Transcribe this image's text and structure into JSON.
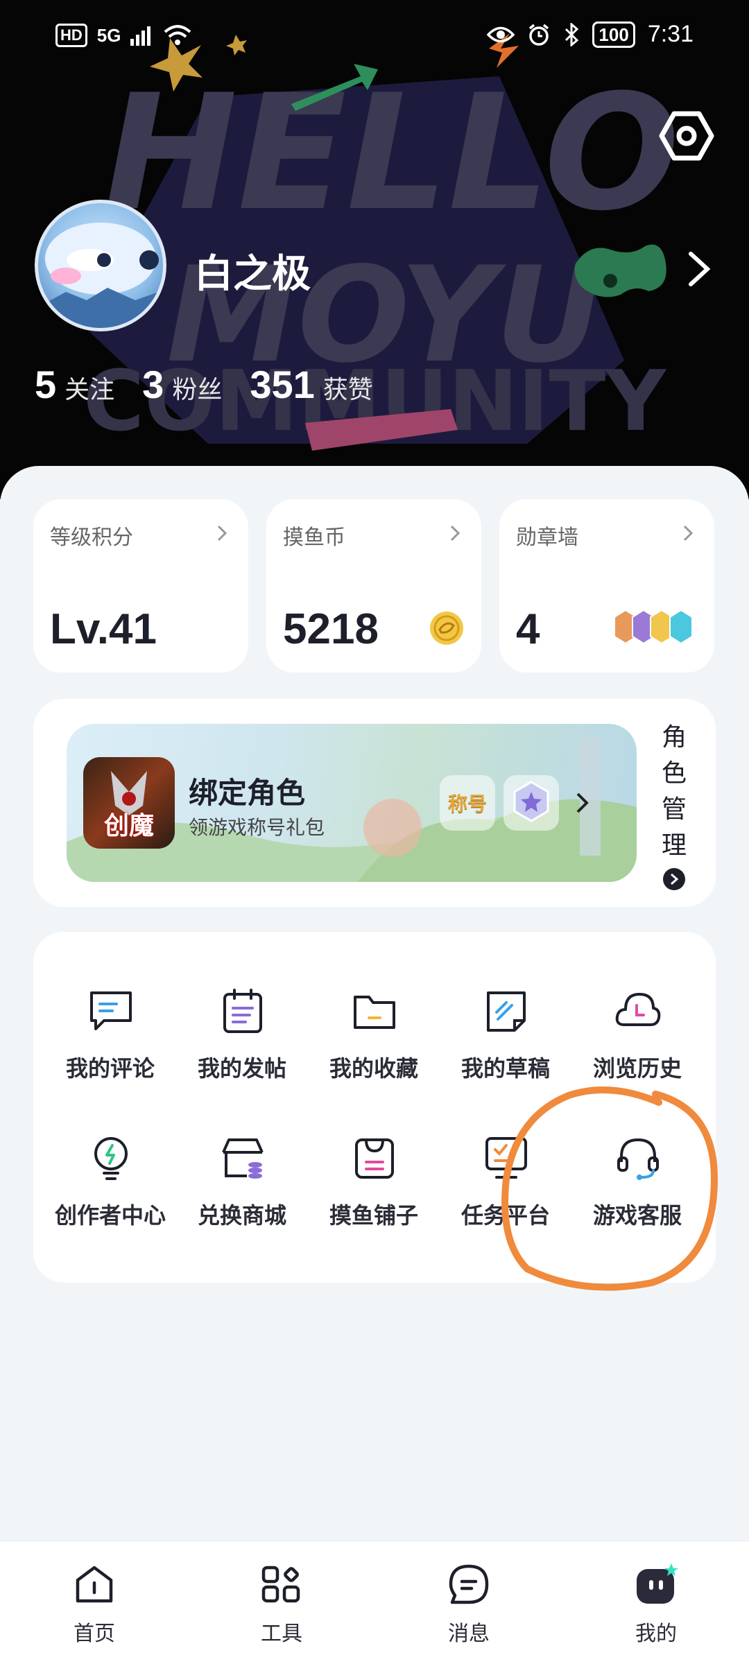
{
  "statusbar": {
    "hd": "HD",
    "signal": "5G",
    "battery": "100",
    "time": "7:31"
  },
  "header": {
    "bg_text_1": "HELLO",
    "bg_text_2": "MOYU",
    "bg_text_3": "COMMUNITY"
  },
  "profile": {
    "username": "白之极",
    "stats": [
      {
        "num": "5",
        "label": "关注"
      },
      {
        "num": "3",
        "label": "粉丝"
      },
      {
        "num": "351",
        "label": "获赞"
      }
    ]
  },
  "cards": {
    "level": {
      "title": "等级积分",
      "value": "Lv.41"
    },
    "coins": {
      "title": "摸鱼币",
      "value": "5218"
    },
    "medals": {
      "title": "勋章墙",
      "value": "4"
    }
  },
  "bind": {
    "icon_text": "创魔",
    "title": "绑定角色",
    "subtitle": "领游戏称号礼包",
    "badge_text": "称号",
    "role_manage": "角色管理"
  },
  "grid": {
    "items": [
      {
        "label": "我的评论",
        "icon": "comment-icon"
      },
      {
        "label": "我的发帖",
        "icon": "post-icon"
      },
      {
        "label": "我的收藏",
        "icon": "folder-icon"
      },
      {
        "label": "我的草稿",
        "icon": "draft-icon"
      },
      {
        "label": "浏览历史",
        "icon": "history-icon"
      },
      {
        "label": "创作者中心",
        "icon": "bulb-icon"
      },
      {
        "label": "兑换商城",
        "icon": "store-icon"
      },
      {
        "label": "摸鱼铺子",
        "icon": "bag-icon"
      },
      {
        "label": "任务平台",
        "icon": "task-icon"
      },
      {
        "label": "游戏客服",
        "icon": "headset-icon"
      }
    ]
  },
  "nav": {
    "items": [
      {
        "label": "首页",
        "icon": "home-icon"
      },
      {
        "label": "工具",
        "icon": "tools-icon"
      },
      {
        "label": "消息",
        "icon": "message-icon"
      },
      {
        "label": "我的",
        "icon": "me-icon"
      }
    ]
  },
  "colors": {
    "accent": "#1d1f2a",
    "annotation": "#f08a3c",
    "coin": "#f3c744"
  }
}
